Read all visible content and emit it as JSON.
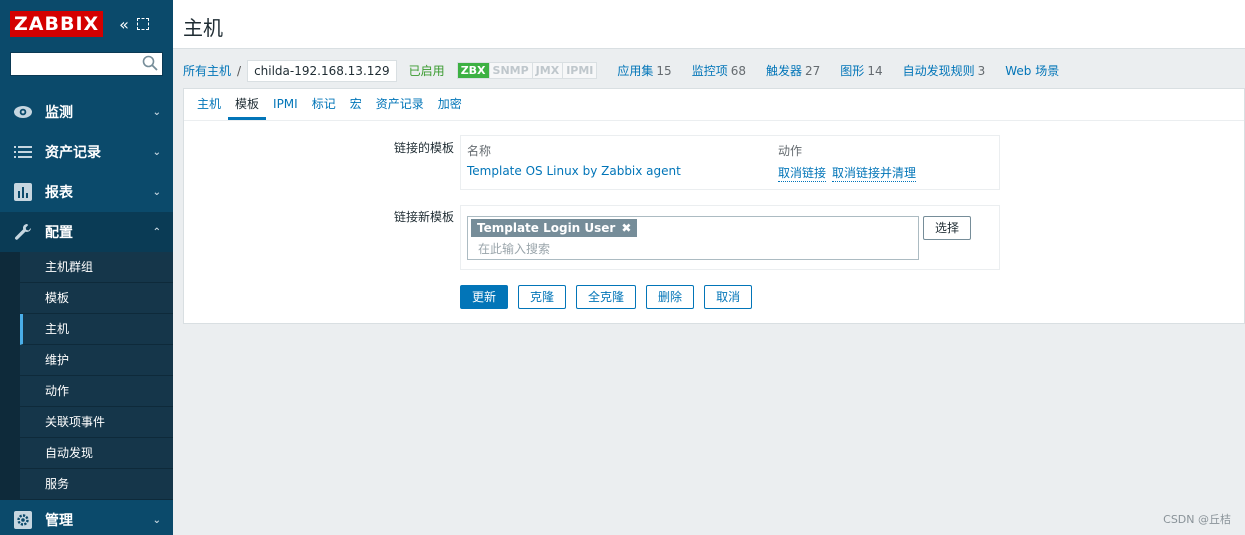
{
  "sidebar": {
    "logo": "ZABBIX",
    "collapse_icon": "«",
    "search_placeholder": "",
    "menu": [
      {
        "label": "监测",
        "icon": "eye-icon"
      },
      {
        "label": "资产记录",
        "icon": "list-icon"
      },
      {
        "label": "报表",
        "icon": "bar-chart-icon"
      },
      {
        "label": "配置",
        "icon": "wrench-icon"
      },
      {
        "label": "管理",
        "icon": "gear-icon"
      }
    ],
    "submenu": [
      "主机群组",
      "模板",
      "主机",
      "维护",
      "动作",
      "关联项事件",
      "自动发现",
      "服务"
    ]
  },
  "header": {
    "title": "主机"
  },
  "navbar": {
    "all_hosts": "所有主机",
    "separator": "/",
    "host_name": "childa-192.168.13.129",
    "status": "已启用",
    "availability": [
      "ZBX",
      "SNMP",
      "JMX",
      "IPMI"
    ],
    "links": [
      {
        "label": "应用集",
        "count": "15"
      },
      {
        "label": "监控项",
        "count": "68"
      },
      {
        "label": "触发器",
        "count": "27"
      },
      {
        "label": "图形",
        "count": "14"
      },
      {
        "label": "自动发现规则",
        "count": "3"
      },
      {
        "label": "Web 场景",
        "count": ""
      }
    ]
  },
  "tabs": [
    "主机",
    "模板",
    "IPMI",
    "标记",
    "宏",
    "资产记录",
    "加密"
  ],
  "form": {
    "linked_label": "链接的模板",
    "col_name": "名称",
    "col_action": "动作",
    "linked_template": "Template OS Linux by Zabbix agent",
    "unlink": "取消链接",
    "unlink_clear": "取消链接并清理",
    "new_label": "链接新模板",
    "chip": "Template Login User",
    "search_placeholder": "在此输入搜索",
    "select_button": "选择"
  },
  "buttons": {
    "update": "更新",
    "clone": "克隆",
    "full_clone": "全克隆",
    "delete": "删除",
    "cancel": "取消"
  },
  "watermark": "CSDN @丘桔",
  "colors": {
    "sidebar": "#0b4a6b",
    "accent": "#0275b8",
    "logo": "#d40000",
    "enabled": "#3a9b2f"
  }
}
